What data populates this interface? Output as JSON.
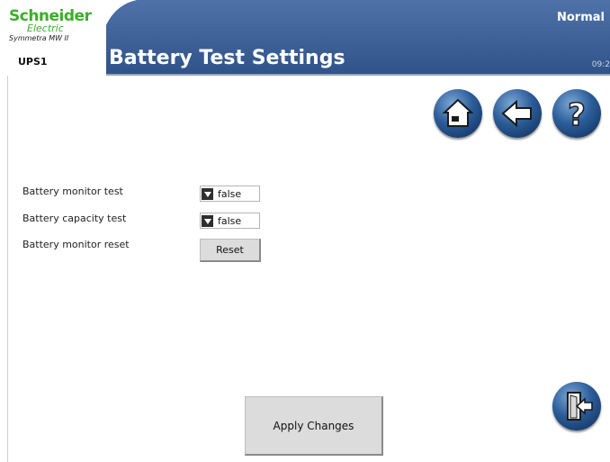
{
  "brand": {
    "name": "Schneider",
    "sub": "Electric",
    "product": "Symmetra MW II"
  },
  "header": {
    "device": "UPS1",
    "title": "Battery Test Settings",
    "status": "Normal",
    "clock": "09:2"
  },
  "colors": {
    "header_bg": "#3d5f94",
    "brand_green": "#3dae2b",
    "button_bg": "#dcdcdc"
  },
  "nav": {
    "home_icon": "home-icon",
    "back_icon": "back-arrow-icon",
    "help_icon": "help-icon",
    "exit_icon": "exit-door-icon"
  },
  "settings": [
    {
      "label": "Battery monitor test",
      "value": "false"
    },
    {
      "label": "Battery capacity test",
      "value": "false"
    },
    {
      "label": "Battery monitor reset",
      "button": "Reset"
    }
  ],
  "apply_label": "Apply Changes"
}
